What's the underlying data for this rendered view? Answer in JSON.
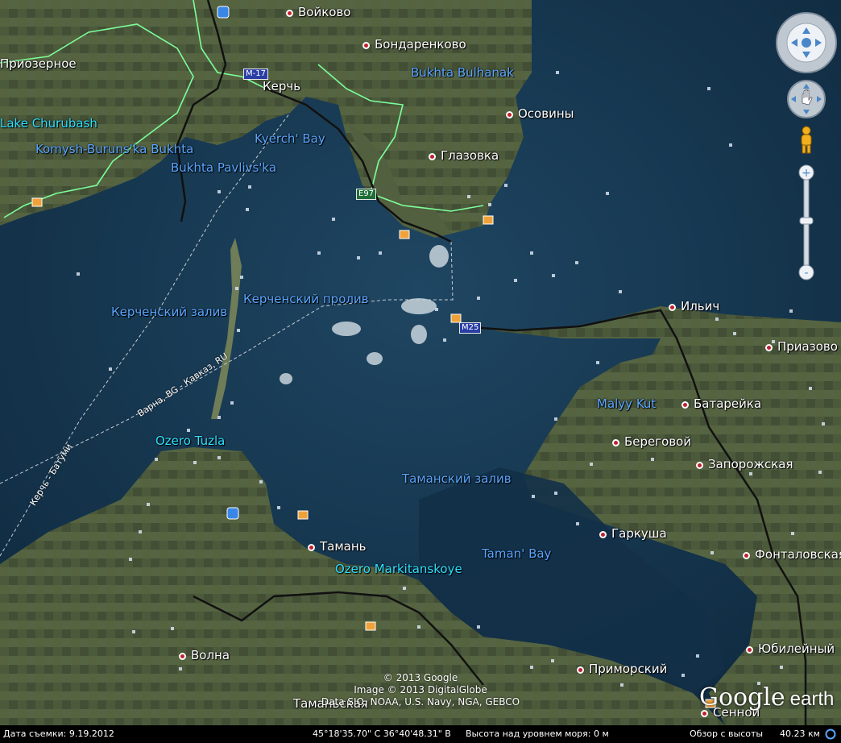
{
  "towns": [
    {
      "name": "Войково",
      "pin": true
    },
    {
      "name": "Бондаренково",
      "pin": true
    },
    {
      "name": "Приозерное",
      "pin": false
    },
    {
      "name": "Керчь",
      "pin": false
    },
    {
      "name": "Осовины",
      "pin": true
    },
    {
      "name": "Глазовка",
      "pin": true
    },
    {
      "name": "Ильич",
      "pin": true
    },
    {
      "name": "Приазово",
      "pin": true
    },
    {
      "name": "Батарейка",
      "pin": true
    },
    {
      "name": "Береговой",
      "pin": true
    },
    {
      "name": "Запорожская",
      "pin": true
    },
    {
      "name": "Гаркуша",
      "pin": true
    },
    {
      "name": "Тамань",
      "pin": true
    },
    {
      "name": "Фонталовская",
      "pin": true
    },
    {
      "name": "Юбилейный",
      "pin": true
    },
    {
      "name": "Волна",
      "pin": true
    },
    {
      "name": "Приморский",
      "pin": true
    },
    {
      "name": "Сенной",
      "pin": true
    },
    {
      "name": "Таманьская",
      "pin": false
    }
  ],
  "water_labels": [
    "Bukhta Bulhanak",
    "Kyerch' Bay",
    "Komysh-Buruns'ka Bukhta",
    "Bukhta Pavlivs'ka",
    "Керченский залив",
    "Керченский пролив",
    "Malyy Kut",
    "Таманский залив",
    "Taman' Bay"
  ],
  "cyan_labels": [
    "Lake Churubash",
    "Ozero Tuzla",
    "Ozero Markitanskoye"
  ],
  "road_shields": [
    {
      "text": "M-17",
      "color": "blue"
    },
    {
      "text": "E97",
      "color": "green"
    },
    {
      "text": "M25",
      "color": "blue"
    }
  ],
  "route_labels": [
    "Варна, BG - Кавказ, RU",
    "Керчь - Батуми"
  ],
  "credits": [
    "© 2013 Google",
    "Image © 2013 DigitalGlobe",
    "Data SIO, NOAA, U.S. Navy, NGA, GEBCO"
  ],
  "logo": {
    "brand": "Google",
    "product": "earth"
  },
  "status": {
    "date": "Дата съемки: 9.19.2012",
    "coords": "45°18'35.70\" С  36°40'48.31\" В",
    "elevation": "Высота над уровнем моря:    0 м",
    "eye_alt": "Обзор с высоты",
    "eye_alt_value": "40.23 км"
  },
  "icons": {
    "north": "N",
    "look": "look-joystick-icon",
    "move": "hand-move-icon",
    "street_view": "pegman-icon",
    "zoom_in": "+",
    "zoom_out": "-"
  },
  "colors": {
    "sea": "#16354f",
    "land": "#4a5a3a",
    "border": "#7cff9a",
    "road": "#101010"
  }
}
